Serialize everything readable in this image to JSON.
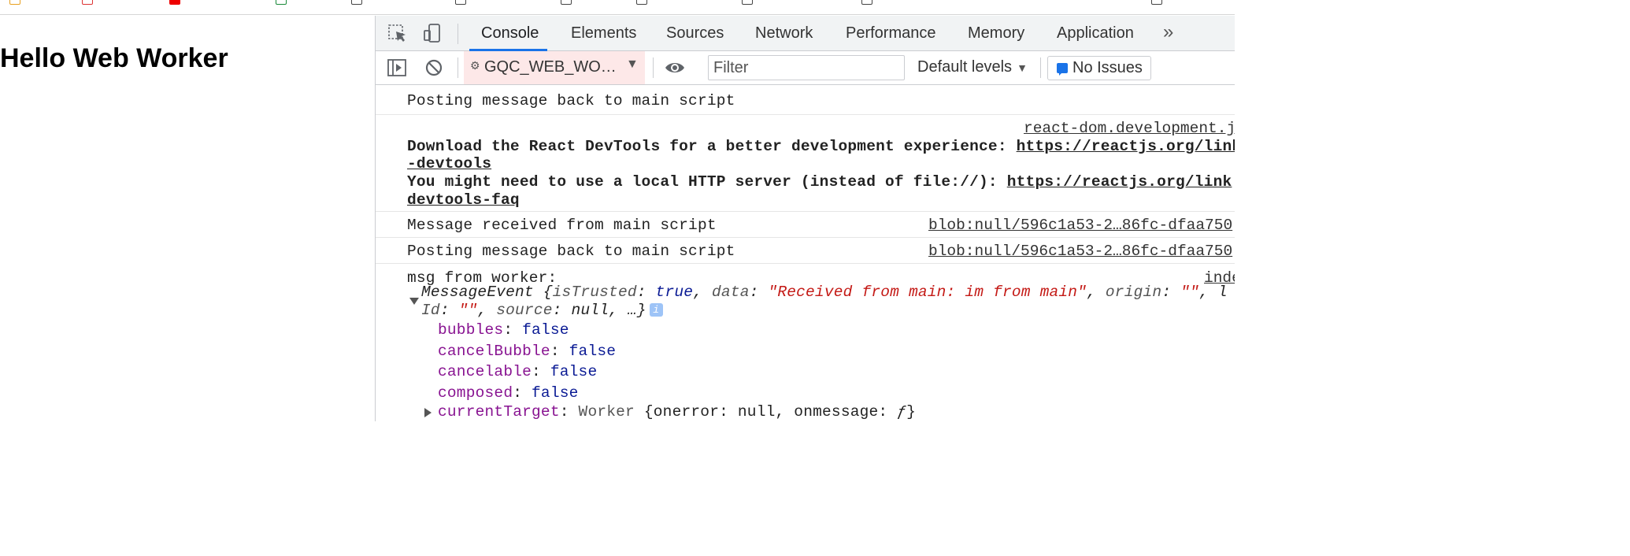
{
  "page": {
    "heading": "Hello Web Worker"
  },
  "devtools": {
    "tabs": [
      {
        "label": "Console",
        "active": true
      },
      {
        "label": "Elements"
      },
      {
        "label": "Sources"
      },
      {
        "label": "Network"
      },
      {
        "label": "Performance"
      },
      {
        "label": "Memory"
      },
      {
        "label": "Application"
      }
    ],
    "toolbar": {
      "context": "GQC_WEB_WO…",
      "filter_placeholder": "Filter",
      "levels": "Default levels",
      "issues": "No Issues"
    },
    "console": {
      "entries": [
        {
          "text": "Posting message back to main script"
        },
        {
          "source": "react-dom.development.j",
          "line1_text": "Download the React DevTools for a better development experience: ",
          "line1_link": "https://reactjs.org/link",
          "line2_link": "-devtools",
          "line3_text": "You might need to use a local HTTP server (instead of file://): ",
          "line3_link": "https://reactjs.org/link",
          "line4_link": "devtools-faq"
        },
        {
          "text": "Message received from main script",
          "source": "blob:null/596c1a53-2…86fc-dfaa750"
        },
        {
          "text": "Posting message back to main script",
          "source": "blob:null/596c1a53-2…86fc-dfaa750"
        },
        {
          "text": "msg from worker:",
          "source": "index",
          "object": {
            "class_name": "MessageEvent",
            "preview_open": "{",
            "k_isTrusted": "isTrusted",
            "v_isTrusted": "true",
            "k_data": "data",
            "v_data": "\"Received from main: im from main\"",
            "k_origin": "origin",
            "v_origin": "\"\"",
            "tail": ", l",
            "k_id": "Id",
            "v_id": "\"\"",
            "k_source": "source",
            "v_source": "null",
            "ellipsis": "…}",
            "info": "i",
            "props": [
              {
                "key": "bubbles",
                "value": "false"
              },
              {
                "key": "cancelBubble",
                "value": "false"
              },
              {
                "key": "cancelable",
                "value": "false"
              },
              {
                "key": "composed",
                "value": "false"
              }
            ],
            "current_target": {
              "key": "currentTarget",
              "class_name": "Worker",
              "preview": "{onerror: null, onmessage: ",
              "fn": "ƒ",
              "close": "}"
            }
          }
        }
      ]
    }
  }
}
